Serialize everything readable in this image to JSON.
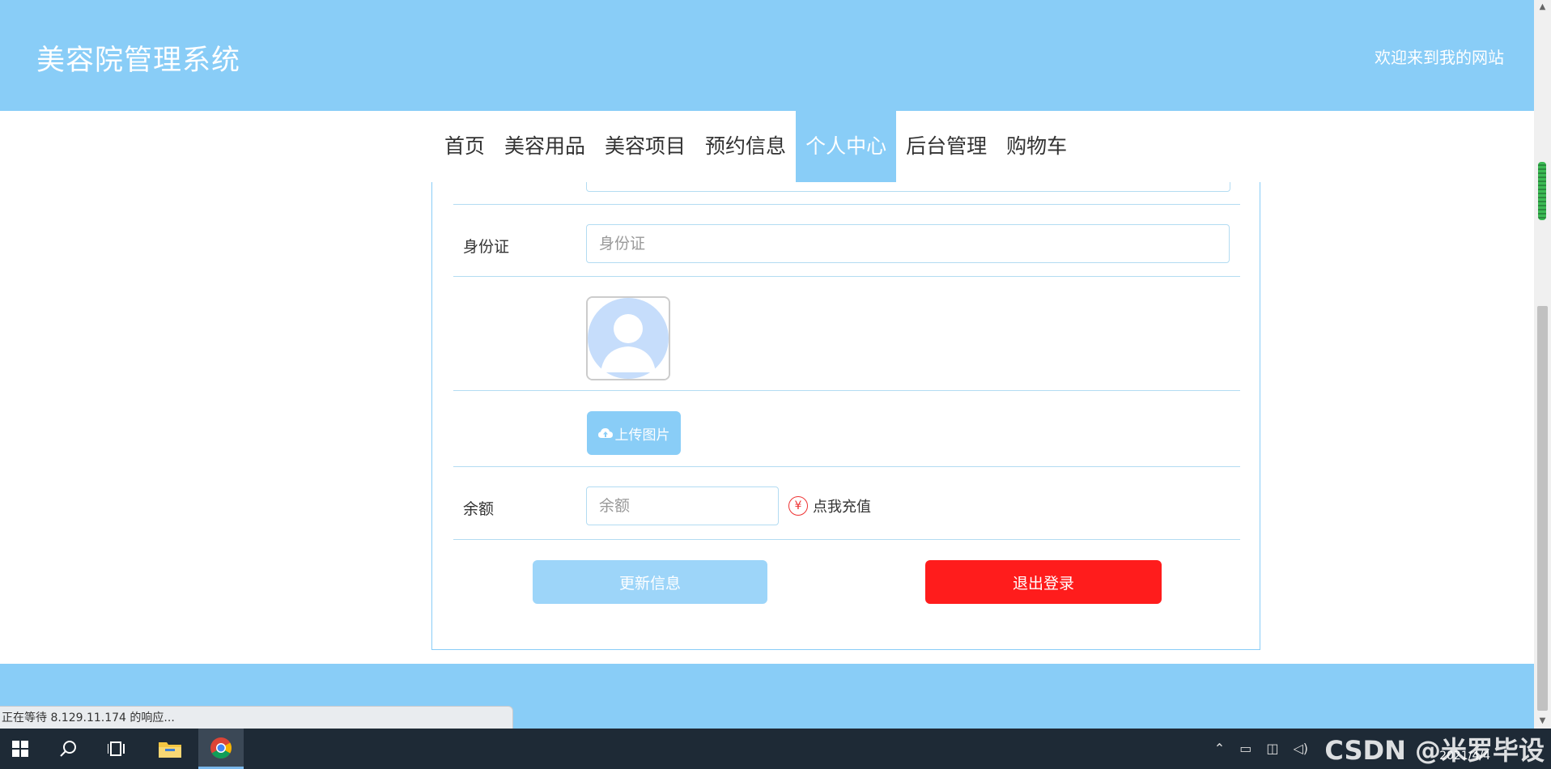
{
  "header": {
    "brand": "美容院管理系统",
    "welcome": "欢迎来到我的网站"
  },
  "nav": {
    "items": [
      {
        "label": "首页"
      },
      {
        "label": "美容用品"
      },
      {
        "label": "美容项目"
      },
      {
        "label": "预约信息"
      },
      {
        "label": "个人中心",
        "active": true
      },
      {
        "label": "后台管理"
      },
      {
        "label": "购物车"
      }
    ]
  },
  "form": {
    "id_card": {
      "label": "身份证",
      "placeholder": "身份证",
      "value": ""
    },
    "upload_label": "上传图片",
    "balance": {
      "label": "余额",
      "placeholder": "余额",
      "value": ""
    },
    "recharge_label": "点我充值",
    "recharge_symbol": "¥"
  },
  "actions": {
    "update_label": "更新信息",
    "logout_label": "退出登录"
  },
  "status_bar": {
    "text": "正在等待 8.129.11.174 的响应..."
  },
  "taskbar": {
    "date": "2021/4/4",
    "watermark": "CSDN @米罗毕设"
  },
  "colors": {
    "primary": "#89cdf7",
    "update_button": "#9dd5f9",
    "logout_button": "#ff1c1c"
  }
}
